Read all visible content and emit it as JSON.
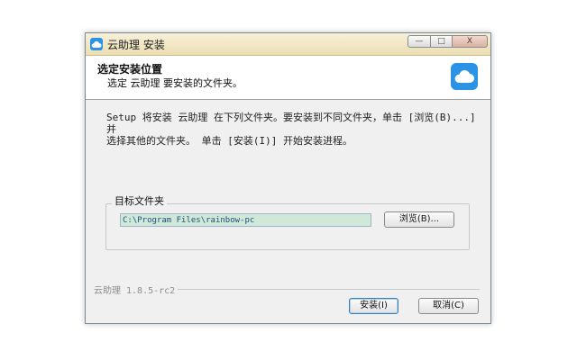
{
  "window": {
    "title": "云助理 安装",
    "controls": {
      "minimize": "—",
      "maximize": "□",
      "close": "X"
    }
  },
  "header": {
    "title": "选定安装位置",
    "subtitle": "选定 云助理 要安装的文件夹。"
  },
  "description": {
    "line1": "Setup 将安装 云助理 在下列文件夹。要安装到不同文件夹，单击 [浏览(B)...] 并",
    "line2": "选择其他的文件夹。 单击 [安装(I)] 开始安装进程。"
  },
  "target_folder": {
    "label": "目标文件夹",
    "path": "C:\\Program Files\\rainbow-pc",
    "browse_label": "浏览(B)..."
  },
  "footer": {
    "version": "云助理 1.8.5-rc2",
    "install_label": "安装(I)",
    "cancel_label": "取消(C)"
  },
  "colors": {
    "accent": "#2a93e6",
    "titlebar": "#ecdfb4",
    "path_highlight": "#cfe8d8"
  },
  "icons": {
    "title": "cloud-icon",
    "header": "cloud-logo-icon"
  }
}
